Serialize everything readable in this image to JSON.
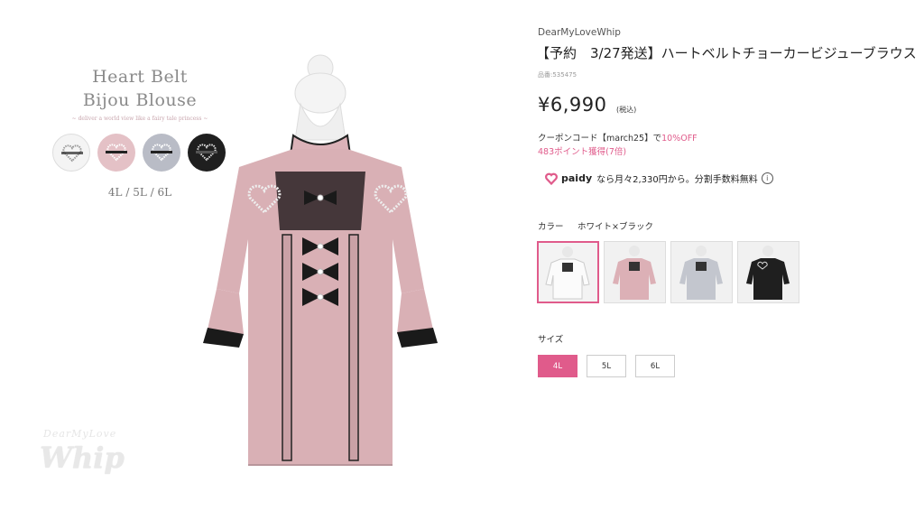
{
  "promo": {
    "title_line1": "Heart Belt",
    "title_line2": "Bijou Blouse",
    "tagline": "~ deliver a world view like a fairy tale princess ~",
    "sizes": "4L / 5L / 6L",
    "swatch_colors": [
      "#f4f4f4",
      "#e4c1c6",
      "#b9bcc6",
      "#1f1f1f"
    ]
  },
  "watermark": {
    "top": "DearMyLove",
    "bottom": "Whip"
  },
  "product": {
    "brand": "DearMyLoveWhip",
    "title": "【予約　3/27発送】ハートベルトチョーカービジューブラウス",
    "code": "品番:535475",
    "price": "¥6,990",
    "tax": "(税込)",
    "coupon_prefix": "クーポンコード【march25】で",
    "coupon_off": "10%OFF",
    "points": "483ポイント獲得(7倍)",
    "paidy_brand": "paidy",
    "paidy_text": "なら月々2,330円から。分割手数料無料",
    "info_glyph": "i",
    "color_label": "カラー",
    "color_value": "ホワイト×ブラック",
    "size_label": "サイズ",
    "sizes": [
      "4L",
      "5L",
      "6L"
    ],
    "selected_size": "4L",
    "accent_color": "#e05b8b"
  }
}
